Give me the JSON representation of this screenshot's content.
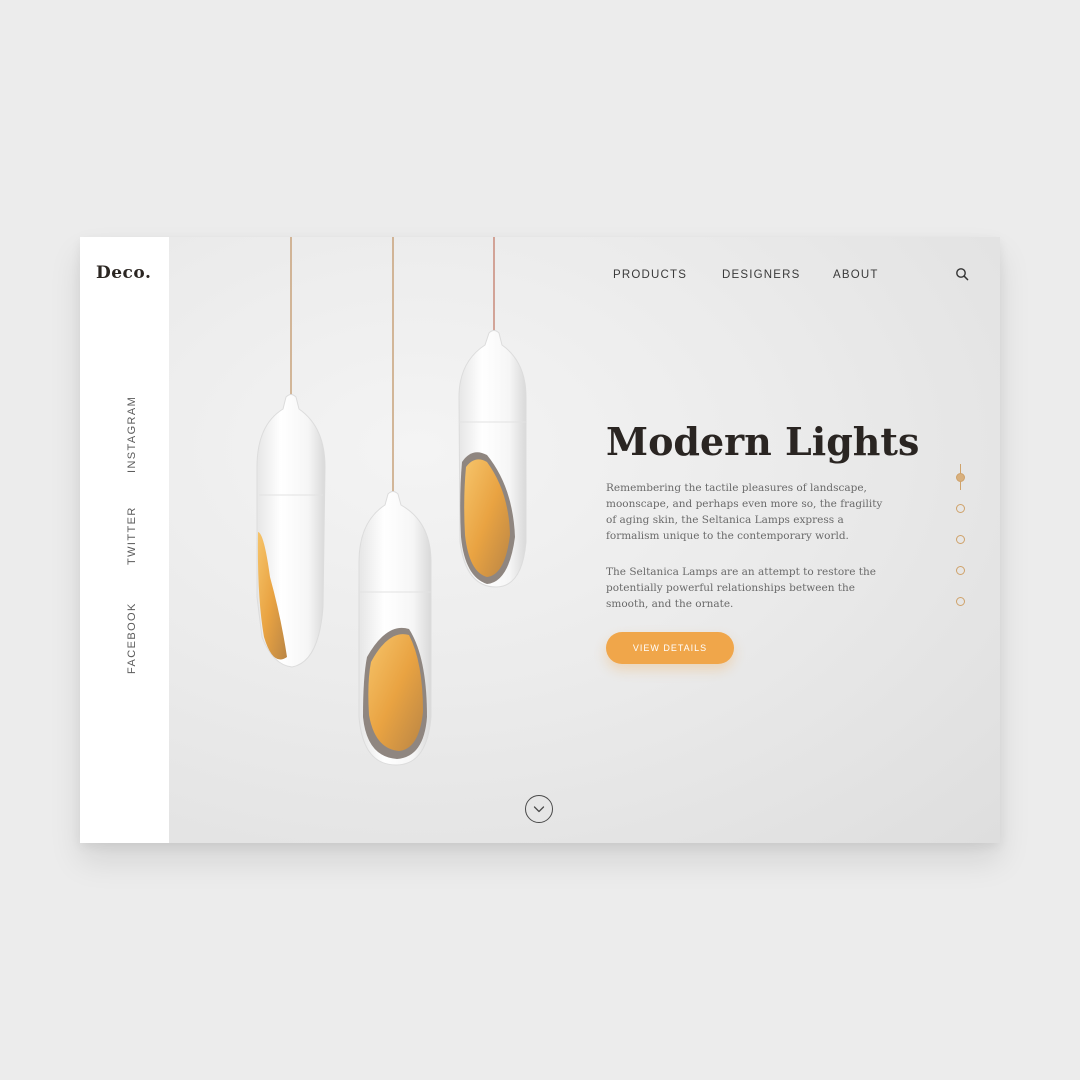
{
  "brand": {
    "logo": "Deco."
  },
  "nav": {
    "items": [
      {
        "label": "PRODUCTS"
      },
      {
        "label": "DESIGNERS"
      },
      {
        "label": "ABOUT"
      }
    ],
    "search_icon": "search-icon"
  },
  "social": {
    "items": [
      {
        "label": "INSTAGRAM"
      },
      {
        "label": "TWITTER"
      },
      {
        "label": "FACEBOOK"
      }
    ]
  },
  "hero": {
    "title": "Modern Lights",
    "paragraph1": "Remembering the tactile pleasures of landscape, moonscape, and perhaps even more so, the fragility of aging skin, the Seltanica Lamps express a formalism unique to the contemporary world.",
    "paragraph2": "The Seltanica Lamps are an attempt to restore the potentially powerful relationships between the smooth, and the ornate.",
    "cta_label": "VIEW DETAILS",
    "scroll_icon": "chevron-down-icon"
  },
  "pagination": {
    "count": 5,
    "active_index": 0
  },
  "colors": {
    "accent": "#f0a64a",
    "text_dark": "#2a2522",
    "dot": "#cfa26a"
  }
}
